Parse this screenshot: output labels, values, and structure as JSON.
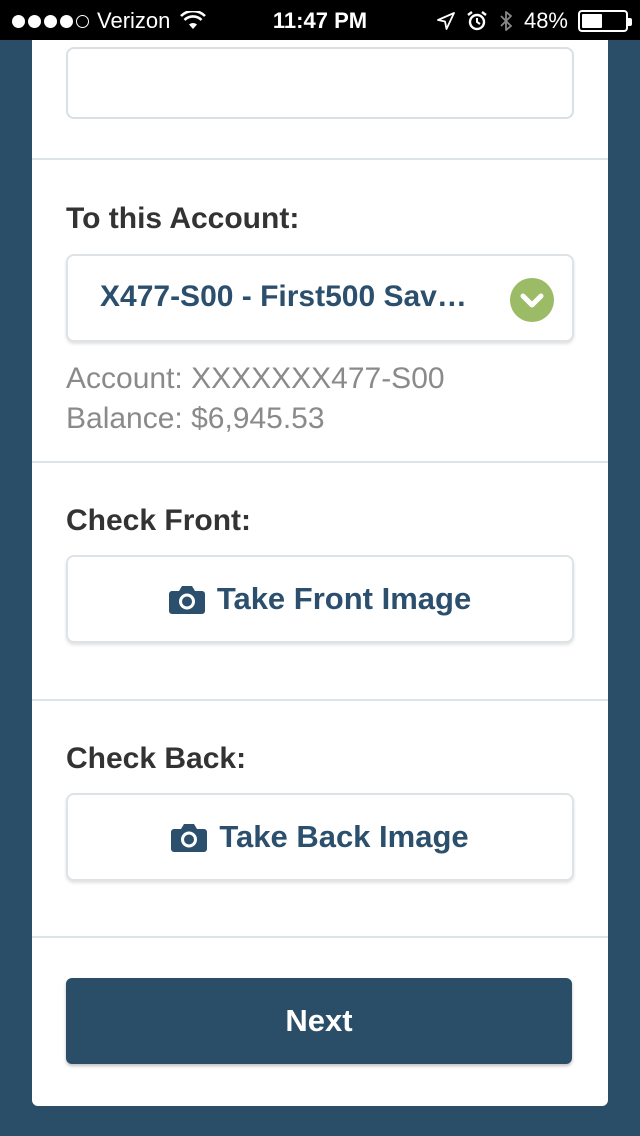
{
  "status_bar": {
    "carrier": "Verizon",
    "time": "11:47 PM",
    "battery_percent": "48%",
    "battery_level": 0.48,
    "signal_bars_filled": 4,
    "signal_bars_total": 5
  },
  "form": {
    "top_field_value": "",
    "to_account": {
      "label": "To this Account:",
      "selected_value": "X477-S00 - First500 Sav…",
      "account_line": "Account: XXXXXXX477-S00",
      "balance_line": "Balance: $6,945.53"
    },
    "check_front": {
      "label": "Check Front:",
      "button_label": "Take Front Image"
    },
    "check_back": {
      "label": "Check Back:",
      "button_label": "Take Back Image"
    },
    "next_label": "Next"
  },
  "colors": {
    "brand": "#2a4d68",
    "accent_text": "#2b4f6c",
    "check_green": "#9bbb66"
  },
  "icons": [
    "wifi-icon",
    "location-arrow-icon",
    "alarm-clock-icon",
    "bluetooth-icon",
    "battery-icon",
    "chevron-down-icon",
    "camera-icon"
  ]
}
